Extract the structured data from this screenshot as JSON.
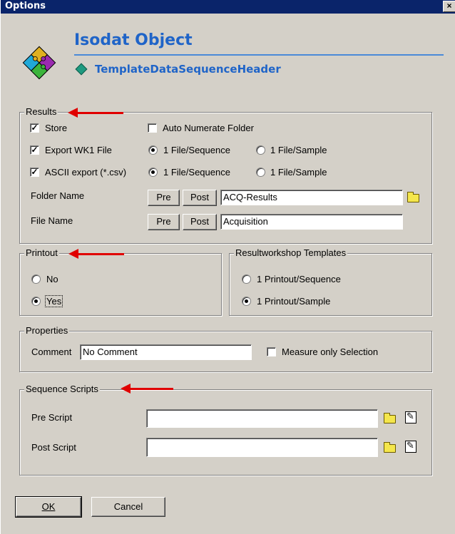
{
  "window": {
    "title": "Options",
    "close": "×"
  },
  "header": {
    "title": "Isodat Object",
    "subtitle": "TemplateDataSequenceHeader"
  },
  "results": {
    "legend": "Results",
    "store": {
      "label": "Store",
      "checked": true
    },
    "auto_numerate": {
      "label": "Auto Numerate Folder",
      "checked": false
    },
    "export_wk1": {
      "label": "Export WK1 File",
      "checked": true,
      "options": [
        "1 File/Sequence",
        "1 File/Sample"
      ],
      "selected": "1 File/Sequence"
    },
    "ascii_export": {
      "label": "ASCII export (*.csv)",
      "checked": true,
      "options": [
        "1 File/Sequence",
        "1 File/Sample"
      ],
      "selected": "1 File/Sequence"
    },
    "folder_name": {
      "label": "Folder Name",
      "pre": "Pre",
      "post": "Post",
      "value": "ACQ-Results"
    },
    "file_name": {
      "label": "File Name",
      "pre": "Pre",
      "post": "Post",
      "value": "Acquisition"
    }
  },
  "printout": {
    "legend": "Printout",
    "no": "No",
    "yes": "Yes",
    "selected": "Yes"
  },
  "templates": {
    "legend": "Resultworkshop Templates",
    "per_sequence": "1 Printout/Sequence",
    "per_sample": "1 Printout/Sample",
    "selected": "1 Printout/Sample"
  },
  "properties": {
    "legend": "Properties",
    "comment_label": "Comment",
    "comment_value": "No Comment",
    "measure_only_selection": {
      "label": "Measure only Selection",
      "checked": false
    }
  },
  "scripts": {
    "legend": "Sequence Scripts",
    "pre_label": "Pre Script",
    "pre_value": "",
    "post_label": "Post Script",
    "post_value": ""
  },
  "footer": {
    "ok": "OK",
    "cancel": "Cancel"
  },
  "colors": {
    "accent": "#1f64c8",
    "annotation_arrow": "#e00000",
    "titlebar": "#0a246a"
  }
}
